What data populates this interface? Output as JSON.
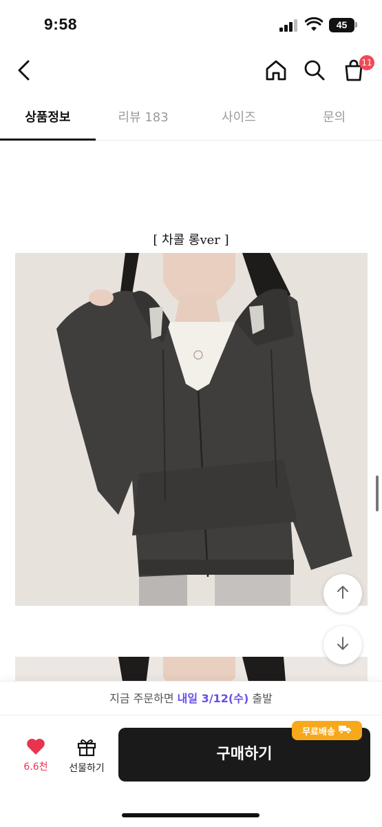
{
  "status_bar": {
    "time": "9:58",
    "battery": "45"
  },
  "header": {
    "back_icon": "chevron-left-icon",
    "home_icon": "home-icon",
    "search_icon": "search-icon",
    "cart_icon": "shopping-bag-icon",
    "cart_count": "11"
  },
  "tabs": [
    {
      "label": "상품정보",
      "active": true
    },
    {
      "label": "리뷰 183",
      "active": false
    },
    {
      "label": "사이즈",
      "active": false
    },
    {
      "label": "문의",
      "active": false
    }
  ],
  "content": {
    "caption": "[ 차콜 롱ver ]"
  },
  "fabs": {
    "up_icon": "arrow-up-icon",
    "down_icon": "arrow-down-icon"
  },
  "shipping_notice": {
    "prefix": "지금 주문하면 ",
    "highlight": "내일 3/12(수)",
    "suffix": " 출발"
  },
  "bottom_bar": {
    "like_icon": "heart-icon",
    "like_count": "6.6천",
    "gift_icon": "gift-icon",
    "gift_label": "선물하기",
    "free_shipping_badge": "무료배송",
    "truck_icon": "truck-icon",
    "buy_label": "구매하기"
  },
  "colors": {
    "accent_purple": "#6a4de8",
    "heart_red": "#e8344e",
    "badge_red": "#f04a58",
    "free_ship_orange": "#f7a81b",
    "buy_button": "#1a1a1a"
  }
}
